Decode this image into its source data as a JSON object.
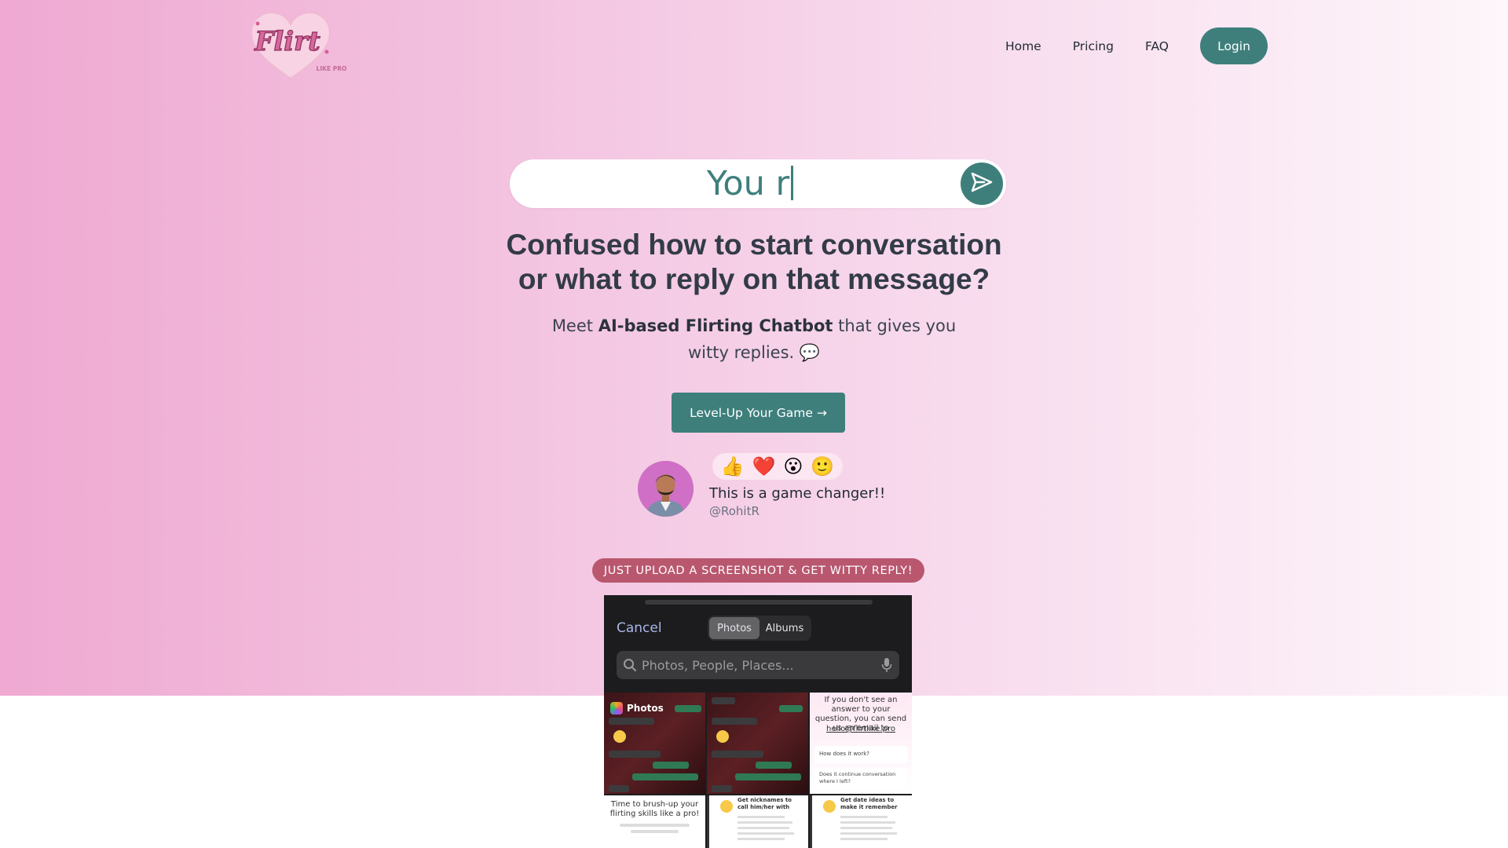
{
  "nav": {
    "logo_text": "Flirt",
    "logo_subtext": "LIKE PRO",
    "links": [
      "Home",
      "Pricing",
      "FAQ"
    ],
    "login_label": "Login"
  },
  "hero": {
    "typed_text": "You r",
    "headline_line1": "Confused how to start conversation",
    "headline_line2": "or what to reply on that message?",
    "sub_prefix": "Meet ",
    "sub_bold": "AI-based Flirting Chatbot",
    "sub_suffix": " that gives you witty replies. 💬",
    "cta_label": "Level-Up Your Game →"
  },
  "testimonial": {
    "reactions": [
      "👍",
      "❤️",
      "😮",
      "🙂"
    ],
    "quote": "This is a game changer!!",
    "handle": "@RohitR"
  },
  "upload_badge": "JUST UPLOAD A SCREENSHOT & GET WITTY REPLY!",
  "phone": {
    "cancel_label": "Cancel",
    "segments": [
      "Photos",
      "Albums"
    ],
    "search_placeholder": "Photos, People, Places...",
    "photos_label": "Photos",
    "faq_tile_text": "If you don't see an answer to your question, you can send us an email to",
    "faq_tile_email": "hello@flirtlike.pro",
    "faq_tile_q1": "How does it work?",
    "faq_tile_q2": "Does it continue conversation where I left?",
    "tile_brush_title": "Time to brush-up your flirting skills like a pro!",
    "tile_nick_title": "Get nicknames to call him/her with",
    "tile_date_title": "Get date ideas to make it remember"
  },
  "colors": {
    "accent": "#3e7f7c",
    "badge": "#b9576f",
    "heading": "#333b48"
  }
}
